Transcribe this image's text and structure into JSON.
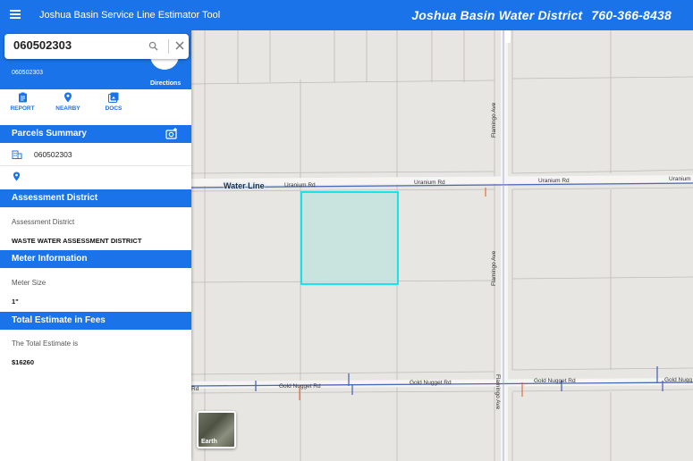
{
  "header": {
    "menu_icon": "hamburger-menu-icon",
    "app_title": "Joshua Basin Service Line Estimator Tool",
    "district_name": "Joshua Basin Water District",
    "district_phone": "760-366-8438"
  },
  "search": {
    "value": "060502303",
    "search_icon": "search-icon",
    "clear_icon": "close-icon"
  },
  "selected": {
    "parcel_id": "060502303",
    "directions_label": "Directions"
  },
  "actions": [
    {
      "label": "REPORT",
      "icon": "report-icon"
    },
    {
      "label": "NEARBY",
      "icon": "location-pin-icon"
    },
    {
      "label": "DOCS",
      "icon": "photos-icon"
    }
  ],
  "parcels_summary": {
    "title": "Parcels Summary",
    "parcel_id": "060502303"
  },
  "assessment": {
    "title": "Assessment District",
    "label": "Assessment District",
    "value": "WASTE WATER ASSESSMENT DISTRICT"
  },
  "meter": {
    "title": "Meter Information",
    "label": "Meter Size",
    "value": "1\""
  },
  "estimate": {
    "title": "Total Estimate in Fees",
    "label": "The Total Estimate is",
    "value": "$16260"
  },
  "map": {
    "water_line_label": "Water Line",
    "roads": {
      "uranium_1": "Uranium Rd",
      "uranium_2": "Uranium Rd",
      "uranium_3": "Uranium Rd",
      "uranium_4": "Uranium",
      "flamingo_1": "Flamingo Ave",
      "flamingo_2": "Flamingo Ave",
      "flamingo_3": "Flamingo Ave",
      "gold_nugget_1": "Gold Nugget Rd",
      "gold_nugget_2": "Gold Nugget Rd",
      "gold_nugget_3": "Gold Nugget Rd",
      "gold_nugget_4": "Gold Nugg",
      "rd_fragment": "Rd"
    },
    "earth_label": "Earth",
    "parcel_highlight_color": "#00e5ee",
    "water_line_color": "#4a67b8"
  }
}
